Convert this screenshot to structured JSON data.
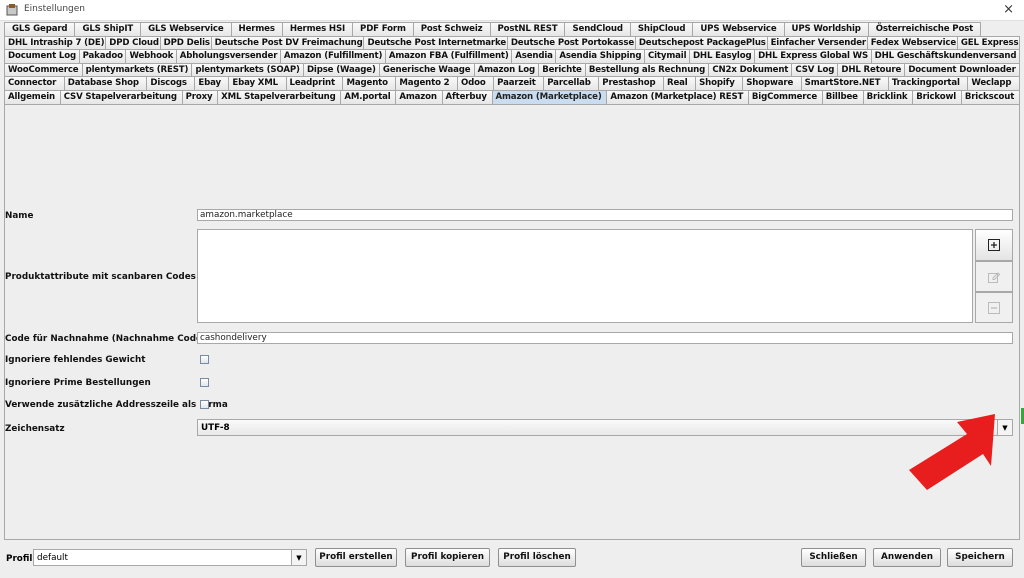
{
  "window": {
    "title": "Einstellungen",
    "close": "×"
  },
  "tabs": {
    "row1": [
      "GLS Gepard",
      "GLS ShipIT",
      "GLS Webservice",
      "Hermes",
      "Hermes HSI",
      "PDF Form",
      "Post Schweiz",
      "PostNL REST",
      "SendCloud",
      "ShipCloud",
      "UPS Webservice",
      "UPS Worldship",
      "Österreichische Post"
    ],
    "row2": [
      "DHL Intraship 7 (DE)",
      "DPD Cloud",
      "DPD Delis",
      "Deutsche Post DV Freimachung",
      "Deutsche Post Internetmarke",
      "Deutsche Post Portokasse",
      "Deutschepost PackagePlus",
      "Einfacher Versender",
      "Fedex Webservice",
      "GEL Express"
    ],
    "row3": [
      "Document Log",
      "Pakadoo",
      "Webhook",
      "Abholungsversender",
      "Amazon (Fulfillment)",
      "Amazon FBA (Fulfillment)",
      "Asendia",
      "Asendia Shipping",
      "Citymail",
      "DHL Easylog",
      "DHL Express Global WS",
      "DHL Geschäftskundenversand"
    ],
    "row4": [
      "WooCommerce",
      "plentymarkets (REST)",
      "plentymarkets (SOAP)",
      "Dipse (Waage)",
      "Generische Waage",
      "Amazon Log",
      "Berichte",
      "Bestellung als Rechnung",
      "CN2x Dokument",
      "CSV Log",
      "DHL Retoure",
      "Document Downloader"
    ],
    "row5": [
      "Connector",
      "Database Shop",
      "Discogs",
      "Ebay",
      "Ebay XML",
      "Leadprint",
      "Magento",
      "Magento 2",
      "Odoo",
      "Paarzeit",
      "Parcellab",
      "Prestashop",
      "Real",
      "Shopify",
      "Shopware",
      "SmartStore.NET",
      "Trackingportal",
      "Weclapp"
    ],
    "row6": [
      "Allgemein",
      "CSV Stapelverarbeitung",
      "Proxy",
      "XML Stapelverarbeitung",
      "AM.portal",
      "Amazon",
      "Afterbuy",
      "Amazon (Marketplace)",
      "Amazon (Marketplace) REST",
      "BigCommerce",
      "Billbee",
      "Bricklink",
      "Brickowl",
      "Brickscout"
    ],
    "active": "Amazon (Marketplace)"
  },
  "form": {
    "name_label": "Name",
    "name_value": "amazon.marketplace",
    "attributes_label": "Produktattribute mit scanbaren Codes",
    "cod_label": "Code für Nachnahme (Nachnahme Code)",
    "cod_value": "cashondelivery",
    "ignore_weight_label": "Ignoriere fehlendes Gewicht",
    "ignore_prime_label": "Ignoriere Prime Bestellungen",
    "extra_address_label": "Verwende zusätzliche Addresszeile als Firma",
    "charset_label": "Zeichensatz",
    "charset_value": "UTF-8"
  },
  "bottom": {
    "profile_label": "Profil",
    "profile_value": "default",
    "create": "Profil erstellen",
    "copy": "Profil kopieren",
    "delete": "Profil löschen",
    "close": "Schließen",
    "apply": "Anwenden",
    "save": "Speichern"
  },
  "colors": {
    "active_tab": "#c9dcf0",
    "arrow": "#e81d1d",
    "panel": "#eeeeee"
  }
}
